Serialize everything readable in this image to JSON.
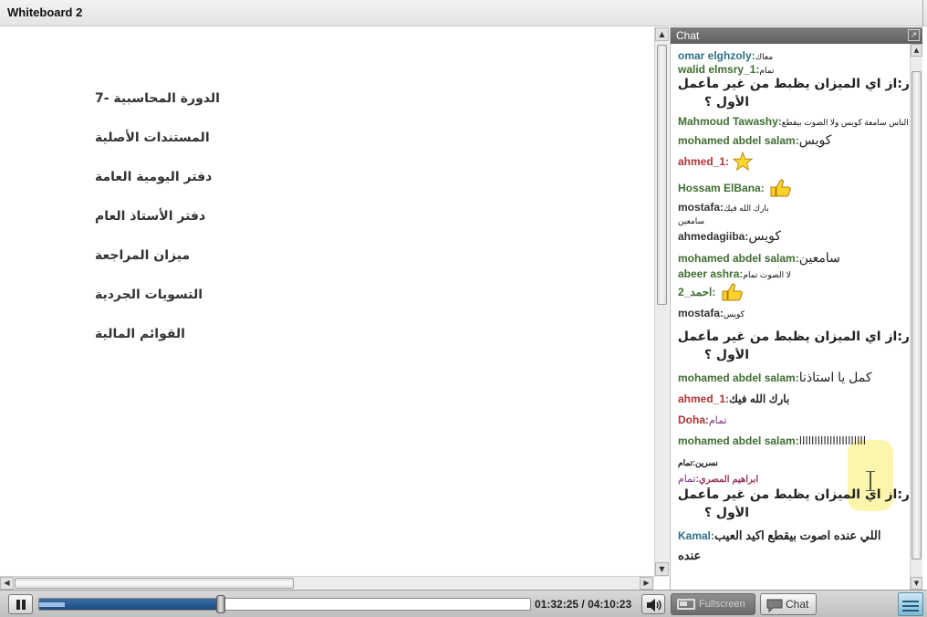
{
  "window": {
    "title": "Whiteboard 2"
  },
  "whiteboard": {
    "topics": [
      "الدورة المحاسبية -7",
      "المستندات الأصلية",
      "دفتر اليومية العامة",
      "دفتر الأستاذ العام",
      "ميزان المراجعة",
      "التسويات الجردية",
      "القوائم المالية"
    ]
  },
  "chat": {
    "header": "Chat",
    "messages": [
      {
        "name": "omar elghzoly:",
        "text": "معاك",
        "color": "teal"
      },
      {
        "name": "walid elmsry_1:",
        "text": "تمام",
        "color": "green"
      },
      {
        "name": "",
        "text": "ر:از اي الميزان يظبط من غير مأعمل تسويات الأول ؟"
      },
      {
        "name": "Mahmoud Tawashy:",
        "text": "الناس سامعة كويس ولا الصوت بيقطع",
        "color": "green"
      },
      {
        "name": "mohamed abdel salam:",
        "text": "كويس",
        "color": "green"
      },
      {
        "name": "ahmed_1:",
        "text": "",
        "emoji": "star-icon",
        "color": "red"
      },
      {
        "name": "Hossam ElBana:",
        "text": "",
        "emoji": "thumbs-up-icon",
        "color": "green"
      },
      {
        "name": "mostafa:",
        "text": "بارك الله فيك",
        "color": "dark"
      },
      {
        "name": "",
        "text": "سامعين"
      },
      {
        "name": "ahmedagiiba:",
        "text": "كويس",
        "color": "dark"
      },
      {
        "name": "mohamed abdel salam:",
        "text": "سامعين",
        "color": "green"
      },
      {
        "name": "abeer ashra:",
        "text": "لا الصوت تمام",
        "color": "green"
      },
      {
        "name": "احمد_2:",
        "text": "",
        "emoji": "thumbs-up-icon",
        "color": "green"
      },
      {
        "name": "mostafa:",
        "text": "كويس",
        "color": "dark"
      },
      {
        "name": "",
        "text": "ر:از اي الميزان يظبط من غير مأعمل تسويات الأول ؟"
      },
      {
        "name": "mohamed abdel salam:",
        "text": "كمل يا استاذنا",
        "color": "green"
      },
      {
        "name": "ahmed_1:",
        "text": "بارك الله فيك",
        "color": "red"
      },
      {
        "name": "Doha:",
        "text": "تمام",
        "color": "red"
      },
      {
        "name": "mohamed abdel salam:",
        "text": "اااااااااااااااااااااا",
        "color": "green"
      },
      {
        "name": "",
        "text": "نسرين:تمام"
      },
      {
        "name": "ابراهيم المصري:",
        "text": "تمام",
        "color": "rose"
      },
      {
        "name": "",
        "text": "ر:از اي الميزان يظبط من غير مأعمل تسويات الأول ؟"
      },
      {
        "name": "Kamal:",
        "text": "اللي عنده اصوت بيقطع اكيد العيب",
        "color": "teal"
      },
      {
        "name": "",
        "text": "عنده"
      }
    ],
    "q_line1": "ر:از اي الميزان يظبط من غير مأعمل تسويات",
    "q_line2": "الأول ؟"
  },
  "player": {
    "time_current": "01:32:25",
    "time_separator": "/",
    "time_total": "04:10:23",
    "progress_fraction": 0.37,
    "fullscreen_label": "Fullscreen",
    "chat_label": "Chat"
  },
  "colors": {
    "green_name": "#3f6e31",
    "red_name": "#b03535",
    "teal_name": "#2f6f83",
    "progress_fill": "#1d4b80"
  }
}
